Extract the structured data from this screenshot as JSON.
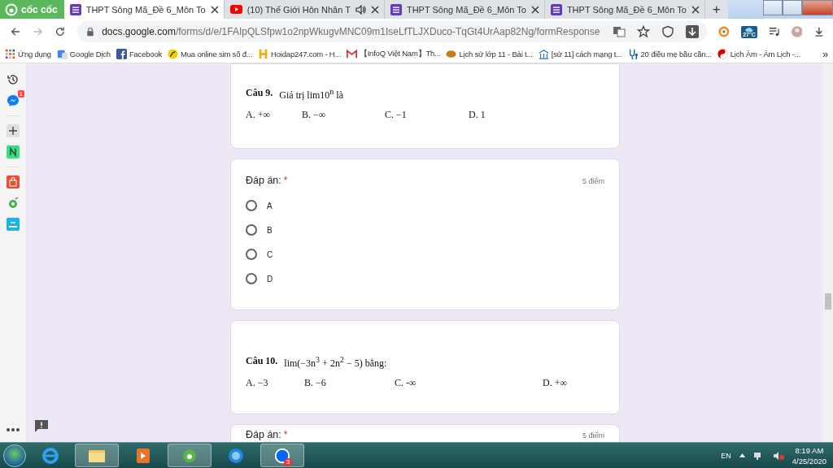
{
  "browser": {
    "brand": "cốc cốc",
    "tabs": [
      {
        "title": "THPT Sông Mã_Đề 6_Môn To",
        "kind": "form",
        "audio": false,
        "selected": true
      },
      {
        "title": "(10) Thế Giới Hôn Nhân T",
        "kind": "video",
        "audio": true,
        "selected": false
      },
      {
        "title": "THPT Sông Mã_Đề 6_Môn To",
        "kind": "form",
        "audio": false,
        "selected": false
      },
      {
        "title": "THPT Sông Mã_Đề 6_Môn To",
        "kind": "form",
        "audio": false,
        "selected": false
      }
    ],
    "new_tab": "+",
    "address": {
      "host": "docs.google.com",
      "path": "/forms/d/e/1FAIpQLSfpw1o2npWkugvMNC09m1IseLfTLJXDuco-TqGt4UrAap82Ng/formResponse"
    },
    "weather": "27°C"
  },
  "bookmarks": [
    {
      "label": "Ứng dụng",
      "kind": "apps"
    },
    {
      "label": "Google Dịch",
      "kind": "translate"
    },
    {
      "label": "Facebook",
      "kind": "facebook"
    },
    {
      "label": "Mua online sim số đ...",
      "kind": "star"
    },
    {
      "label": "Hoidap247.com - H...",
      "kind": "h"
    },
    {
      "label": "【InfoQ Việt Nam】Th...",
      "kind": "mail"
    },
    {
      "label": "Lịch sử lớp 11 - Bài t...",
      "kind": "ball"
    },
    {
      "label": "[sử 11] cách mạng t...",
      "kind": "temple"
    },
    {
      "label": "20 điều mẹ bầu cần...",
      "kind": "stetho"
    },
    {
      "label": "Lịch Âm - Âm Lịch -...",
      "kind": "yinyang"
    }
  ],
  "bookmarks_more": "»",
  "sidebar": {
    "messenger_badge": "1"
  },
  "form": {
    "cards": [
      {
        "kind": "question",
        "number": "Câu 9.",
        "text": "Giá trị lim10$^{n}$ là",
        "options": [
          "A. +∞",
          "B. −∞",
          "C. −1",
          "D. 1"
        ]
      },
      {
        "kind": "answer",
        "label": "Đáp án:",
        "required_mark": "*",
        "points": "5 điểm",
        "choices": [
          {
            "label": "A",
            "selected": false
          },
          {
            "label": "B",
            "selected": false
          },
          {
            "label": "C",
            "selected": false
          },
          {
            "label": "D",
            "selected": false
          }
        ]
      },
      {
        "kind": "question",
        "number": "Câu 10.",
        "text": "lim(−3n$^{3}$ + 2n$^{2}$ − 5) bằng:",
        "options": [
          "A. −3",
          "B. −6",
          "C. -∞",
          "D. +∞"
        ]
      },
      {
        "kind": "answer_top",
        "label": "Đáp án:",
        "required_mark": "*",
        "points": "5 điểm"
      }
    ]
  },
  "taskbar": {
    "zalo_badge": "3",
    "language": "EN",
    "time": "8:19 AM",
    "date": "4/25/2020"
  }
}
